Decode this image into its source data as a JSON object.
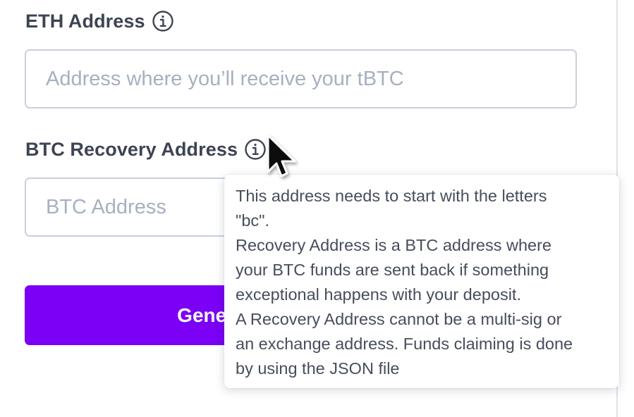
{
  "eth": {
    "label": "ETH Address",
    "value": "",
    "placeholder": "Address where you’ll receive your tBTC"
  },
  "btc": {
    "label": "BTC Recovery Address",
    "value": "",
    "placeholder": "BTC Address"
  },
  "generate_button": {
    "label": "Generate Deposit Address"
  },
  "tooltip": {
    "lines": [
      "This address needs to start with the letters",
      "\"bc\".",
      "Recovery Address is a BTC address where",
      "your BTC funds are sent back if something",
      "exceptional happens with your deposit.",
      "A Recovery Address cannot be a multi-sig or",
      "an exchange address. Funds claiming is done",
      "by using the JSON file"
    ]
  },
  "icons": {
    "info": "info-circle-icon",
    "cursor": "mouse-pointer-icon"
  },
  "colors": {
    "accent": "#7b00f5",
    "label": "#3d4453",
    "placeholder": "#a7b0c0",
    "border": "#c9d0da"
  }
}
